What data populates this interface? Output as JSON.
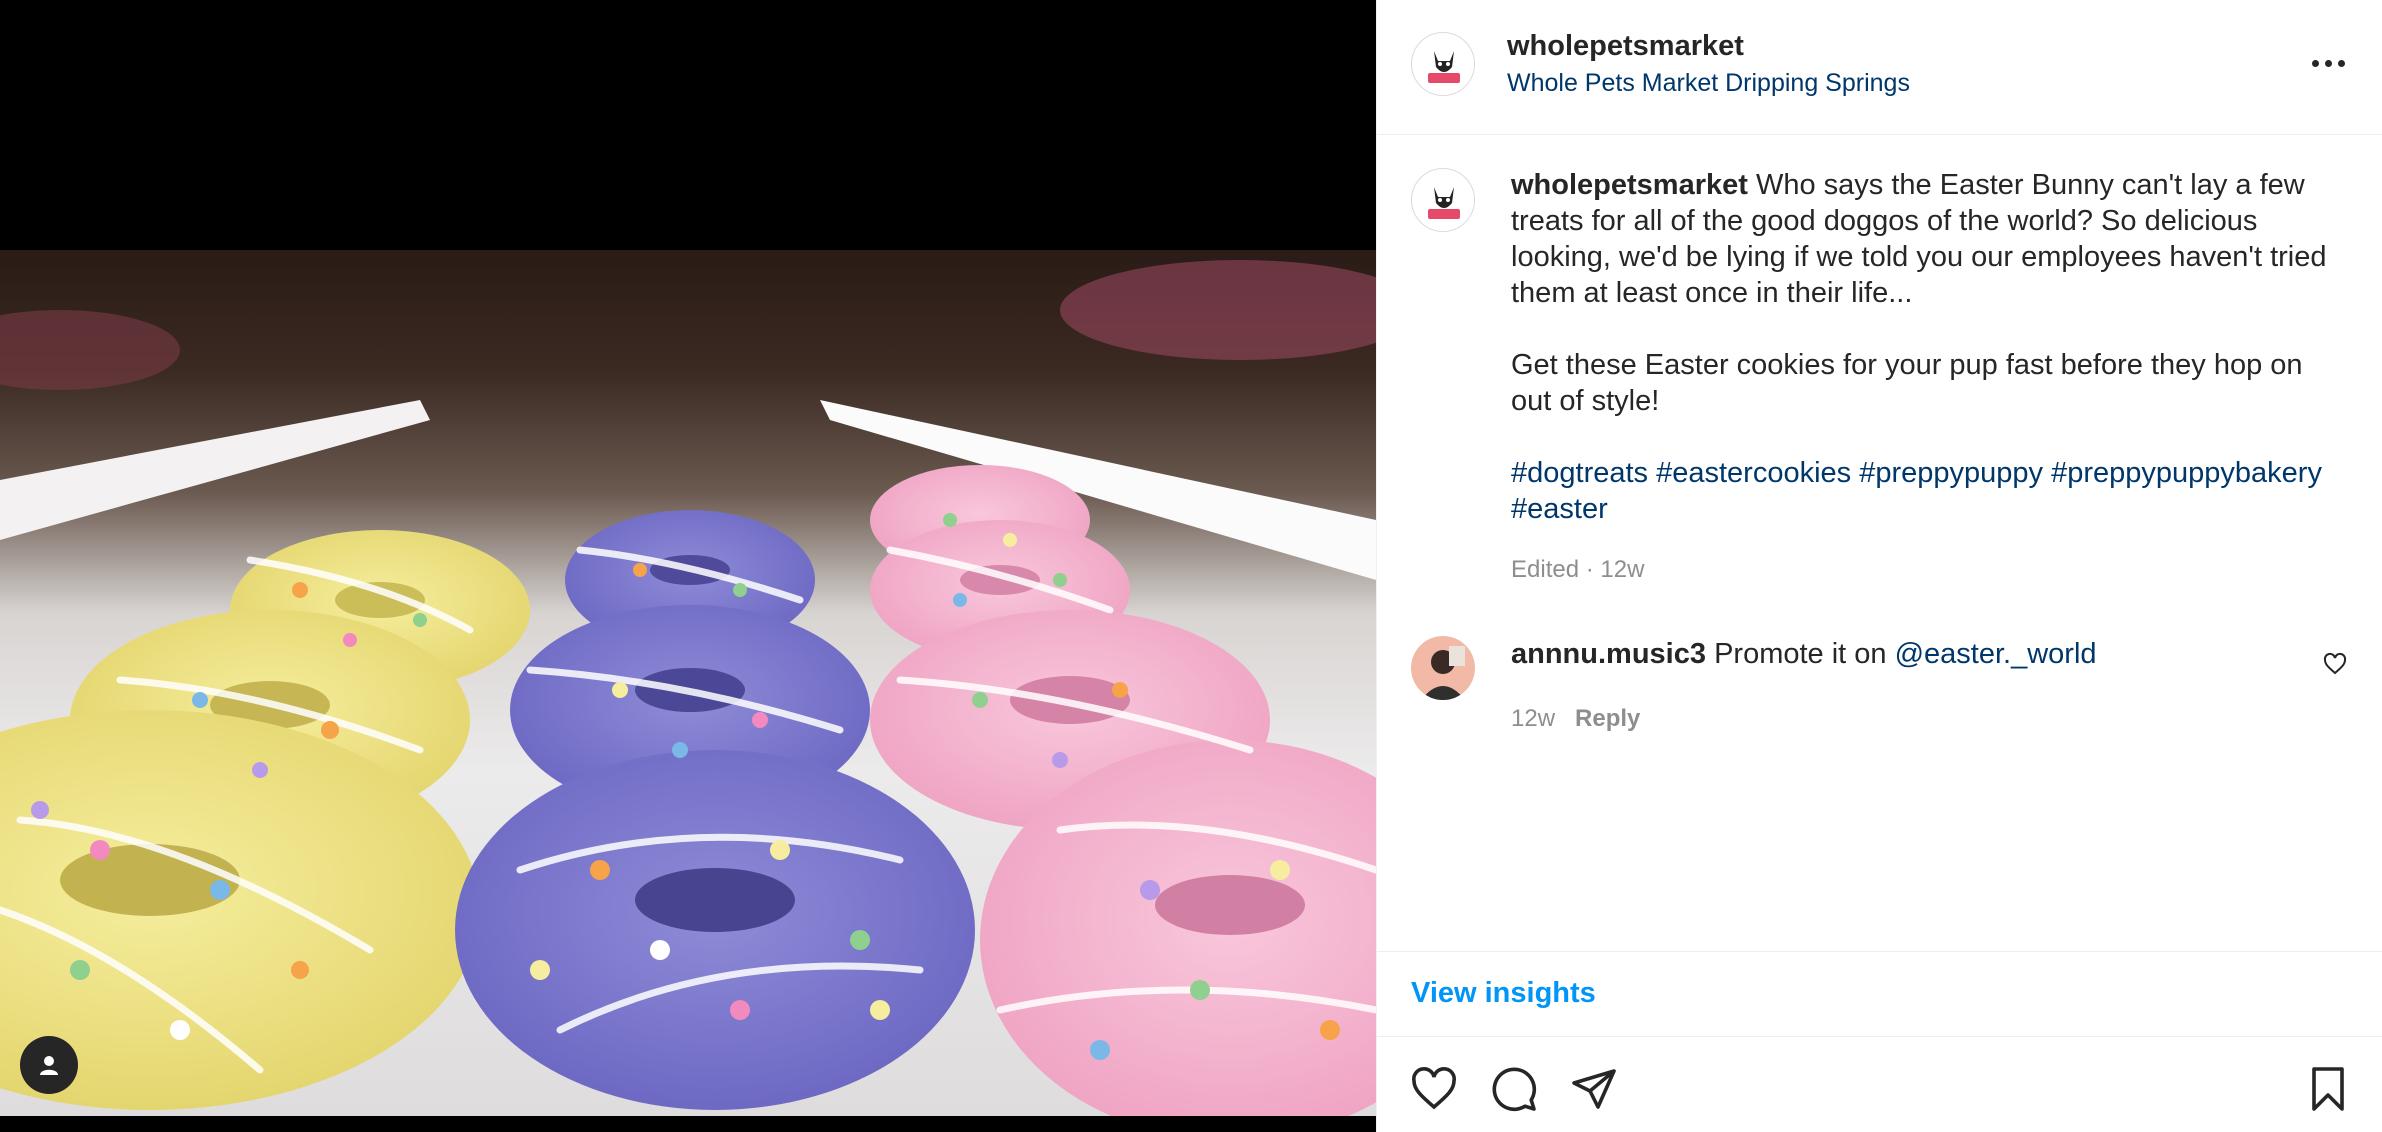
{
  "post": {
    "username": "wholepetsmarket",
    "location": "Whole Pets Market Dripping Springs"
  },
  "caption": {
    "username": "wholepetsmarket",
    "text_1": "Who says the Easter Bunny can't lay a few treats for all of the good doggos of the world? So delicious looking, we'd be lying if we told you our employees haven't tried them at least once in their life...",
    "text_2": "Get these Easter cookies for your pup fast before they hop on out of style!",
    "hashtags": "#dogtreats #eastercookies #preppypuppy #preppypuppybakery #easter",
    "edited_label": "Edited · 12w"
  },
  "comments": [
    {
      "username": "annnu.music3",
      "text": "Promote it on ",
      "mention": "@easter._world",
      "age": "12w",
      "reply_label": "Reply"
    }
  ],
  "insights_label": "View insights",
  "icons": {
    "more": "more-horizontal-icon",
    "like": "heart-icon",
    "comment": "comment-bubble-icon",
    "share": "paper-plane-icon",
    "save": "bookmark-icon",
    "user_tag": "user-icon"
  },
  "colors": {
    "link": "#00376b",
    "accent": "#0095f6",
    "muted": "#8e8e8e",
    "text": "#262626"
  }
}
